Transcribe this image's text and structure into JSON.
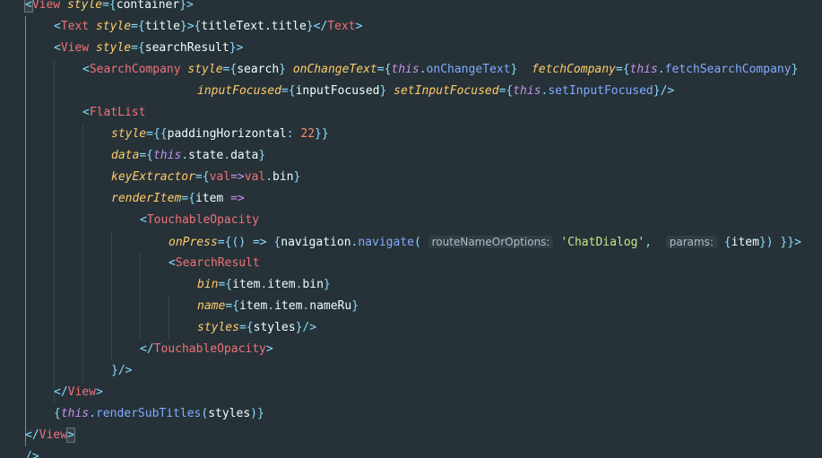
{
  "editor": {
    "lines": [
      {
        "indent": 0,
        "tokens": [
          {
            "t": "<",
            "c": "hl-bracket t-punc"
          },
          {
            "t": "View",
            "c": "t-tag"
          },
          {
            "t": " ",
            "c": "t-ident"
          },
          {
            "t": "style",
            "c": "t-attr"
          },
          {
            "t": "={",
            "c": "t-punc"
          },
          {
            "t": "container",
            "c": "t-ident"
          },
          {
            "t": "}>",
            "c": "t-punc"
          }
        ]
      },
      {
        "indent": 1,
        "tokens": [
          {
            "t": "<",
            "c": "t-punc"
          },
          {
            "t": "Text",
            "c": "t-tag"
          },
          {
            "t": " ",
            "c": "t-ident"
          },
          {
            "t": "style",
            "c": "t-attr"
          },
          {
            "t": "={",
            "c": "t-punc"
          },
          {
            "t": "title",
            "c": "t-ident"
          },
          {
            "t": "}>{",
            "c": "t-punc"
          },
          {
            "t": "titleText.title",
            "c": "t-ident"
          },
          {
            "t": "}</",
            "c": "t-punc"
          },
          {
            "t": "Text",
            "c": "t-tag"
          },
          {
            "t": ">",
            "c": "t-punc"
          }
        ]
      },
      {
        "indent": 1,
        "tokens": [
          {
            "t": "<",
            "c": "t-punc"
          },
          {
            "t": "View",
            "c": "t-tag"
          },
          {
            "t": " ",
            "c": "t-ident"
          },
          {
            "t": "style",
            "c": "t-attr"
          },
          {
            "t": "={",
            "c": "t-punc"
          },
          {
            "t": "searchResult",
            "c": "t-ident"
          },
          {
            "t": "}>",
            "c": "t-punc"
          }
        ]
      },
      {
        "indent": 2,
        "tokens": [
          {
            "t": "<",
            "c": "t-punc"
          },
          {
            "t": "SearchCompany",
            "c": "t-tag"
          },
          {
            "t": " ",
            "c": "t-ident"
          },
          {
            "t": "style",
            "c": "t-attr"
          },
          {
            "t": "={",
            "c": "t-punc"
          },
          {
            "t": "search",
            "c": "t-ident"
          },
          {
            "t": "} ",
            "c": "t-punc"
          },
          {
            "t": "onChangeText",
            "c": "t-attr"
          },
          {
            "t": "={",
            "c": "t-punc"
          },
          {
            "t": "this",
            "c": "t-kw"
          },
          {
            "t": ".",
            "c": "t-punc"
          },
          {
            "t": "onChangeText",
            "c": "t-fn"
          },
          {
            "t": "}  ",
            "c": "t-punc"
          },
          {
            "t": "fetchCompany",
            "c": "t-attr"
          },
          {
            "t": "={",
            "c": "t-punc"
          },
          {
            "t": "this",
            "c": "t-kw"
          },
          {
            "t": ".",
            "c": "t-punc"
          },
          {
            "t": "fetchSearchCompany",
            "c": "t-fn"
          },
          {
            "t": "}",
            "c": "t-punc"
          }
        ]
      },
      {
        "indent": 6,
        "tokens": [
          {
            "t": "inputFocused",
            "c": "t-attr"
          },
          {
            "t": "={",
            "c": "t-punc"
          },
          {
            "t": "inputFocused",
            "c": "t-ident"
          },
          {
            "t": "} ",
            "c": "t-punc"
          },
          {
            "t": "setInputFocused",
            "c": "t-attr"
          },
          {
            "t": "={",
            "c": "t-punc"
          },
          {
            "t": "this",
            "c": "t-kw"
          },
          {
            "t": ".",
            "c": "t-punc"
          },
          {
            "t": "setInputFocused",
            "c": "t-fn"
          },
          {
            "t": "}/>",
            "c": "t-punc"
          }
        ]
      },
      {
        "indent": 2,
        "tokens": [
          {
            "t": "<",
            "c": "t-punc"
          },
          {
            "t": "FlatList",
            "c": "t-tag"
          }
        ]
      },
      {
        "indent": 3,
        "tokens": [
          {
            "t": "style",
            "c": "t-attr"
          },
          {
            "t": "={{",
            "c": "t-punc"
          },
          {
            "t": "paddingHorizontal",
            "c": "t-ident"
          },
          {
            "t": ": ",
            "c": "t-punc"
          },
          {
            "t": "22",
            "c": "t-num"
          },
          {
            "t": "}}",
            "c": "t-punc"
          }
        ]
      },
      {
        "indent": 3,
        "tokens": [
          {
            "t": "data",
            "c": "t-attr"
          },
          {
            "t": "={",
            "c": "t-punc"
          },
          {
            "t": "this",
            "c": "t-kw"
          },
          {
            "t": ".",
            "c": "t-punc"
          },
          {
            "t": "state",
            "c": "t-ident"
          },
          {
            "t": ".",
            "c": "t-punc"
          },
          {
            "t": "data",
            "c": "t-ident"
          },
          {
            "t": "}",
            "c": "t-punc"
          }
        ]
      },
      {
        "indent": 3,
        "tokens": [
          {
            "t": "keyExtractor",
            "c": "t-attr"
          },
          {
            "t": "={",
            "c": "t-punc"
          },
          {
            "t": "val",
            "c": "t-tag"
          },
          {
            "t": "=>",
            "c": "t-kw"
          },
          {
            "t": "val",
            "c": "t-tag"
          },
          {
            "t": ".",
            "c": "t-punc"
          },
          {
            "t": "bin",
            "c": "t-ident"
          },
          {
            "t": "}",
            "c": "t-punc"
          }
        ]
      },
      {
        "indent": 3,
        "tokens": [
          {
            "t": "renderItem",
            "c": "t-attr"
          },
          {
            "t": "={",
            "c": "t-punc"
          },
          {
            "t": "item",
            "c": "t-ident"
          },
          {
            "t": " =>",
            "c": "t-kw"
          }
        ]
      },
      {
        "indent": 4,
        "tokens": [
          {
            "t": "<",
            "c": "t-punc"
          },
          {
            "t": "TouchableOpacity",
            "c": "t-tag"
          }
        ]
      },
      {
        "indent": 5,
        "tokens": [
          {
            "t": "onPress",
            "c": "t-attr"
          },
          {
            "t": "={() => {",
            "c": "t-punc"
          },
          {
            "t": "navigation",
            "c": "t-ident"
          },
          {
            "t": ".",
            "c": "t-punc"
          },
          {
            "t": "navigate",
            "c": "t-fn"
          },
          {
            "t": "( ",
            "c": "t-punc"
          },
          {
            "t": "routeNameOrOptions:",
            "c": "t-hint"
          },
          {
            "t": " ",
            "c": "t-ident"
          },
          {
            "t": "'ChatDialog'",
            "c": "t-str"
          },
          {
            "t": ",  ",
            "c": "t-punc"
          },
          {
            "t": "params:",
            "c": "t-hint"
          },
          {
            "t": " {",
            "c": "t-punc"
          },
          {
            "t": "item",
            "c": "t-ident"
          },
          {
            "t": "}) }}>",
            "c": "t-punc"
          }
        ]
      },
      {
        "indent": 5,
        "tokens": [
          {
            "t": "<",
            "c": "t-punc"
          },
          {
            "t": "SearchResult",
            "c": "t-tag"
          }
        ]
      },
      {
        "indent": 6,
        "tokens": [
          {
            "t": "bin",
            "c": "t-attr"
          },
          {
            "t": "={",
            "c": "t-punc"
          },
          {
            "t": "item",
            "c": "t-ident"
          },
          {
            "t": ".",
            "c": "t-punc"
          },
          {
            "t": "item",
            "c": "t-ident"
          },
          {
            "t": ".",
            "c": "t-punc"
          },
          {
            "t": "bin",
            "c": "t-ident"
          },
          {
            "t": "}",
            "c": "t-punc"
          }
        ]
      },
      {
        "indent": 6,
        "tokens": [
          {
            "t": "name",
            "c": "t-attr"
          },
          {
            "t": "={",
            "c": "t-punc"
          },
          {
            "t": "item",
            "c": "t-ident"
          },
          {
            "t": ".",
            "c": "t-punc"
          },
          {
            "t": "item",
            "c": "t-ident"
          },
          {
            "t": ".",
            "c": "t-punc"
          },
          {
            "t": "nameRu",
            "c": "t-ident"
          },
          {
            "t": "}",
            "c": "t-punc"
          }
        ]
      },
      {
        "indent": 6,
        "tokens": [
          {
            "t": "styles",
            "c": "t-attr"
          },
          {
            "t": "={",
            "c": "t-punc"
          },
          {
            "t": "styles",
            "c": "t-ident"
          },
          {
            "t": "}/>",
            "c": "t-punc"
          }
        ]
      },
      {
        "indent": 4,
        "tokens": [
          {
            "t": "</",
            "c": "t-punc"
          },
          {
            "t": "TouchableOpacity",
            "c": "t-tag"
          },
          {
            "t": ">",
            "c": "t-punc"
          }
        ]
      },
      {
        "indent": 3,
        "tokens": [
          {
            "t": "}/>",
            "c": "t-punc"
          }
        ]
      },
      {
        "indent": 1,
        "tokens": [
          {
            "t": "</",
            "c": "t-punc"
          },
          {
            "t": "View",
            "c": "t-tag"
          },
          {
            "t": ">",
            "c": "t-punc"
          }
        ]
      },
      {
        "indent": 1,
        "tokens": [
          {
            "t": "{",
            "c": "t-punc"
          },
          {
            "t": "this",
            "c": "t-kw"
          },
          {
            "t": ".",
            "c": "t-punc"
          },
          {
            "t": "renderSubTitles",
            "c": "t-fn"
          },
          {
            "t": "(",
            "c": "t-punc"
          },
          {
            "t": "styles",
            "c": "t-ident"
          },
          {
            "t": ")}",
            "c": "t-punc"
          }
        ]
      },
      {
        "indent": 0,
        "tokens": [
          {
            "t": "</",
            "c": "t-punc"
          },
          {
            "t": "View",
            "c": "t-tag"
          },
          {
            "t": ">",
            "c": "hl-bracket t-punc"
          }
        ]
      },
      {
        "indent": 0,
        "tokens": [
          {
            "t": "/>",
            "c": "t-punc"
          }
        ]
      }
    ]
  }
}
